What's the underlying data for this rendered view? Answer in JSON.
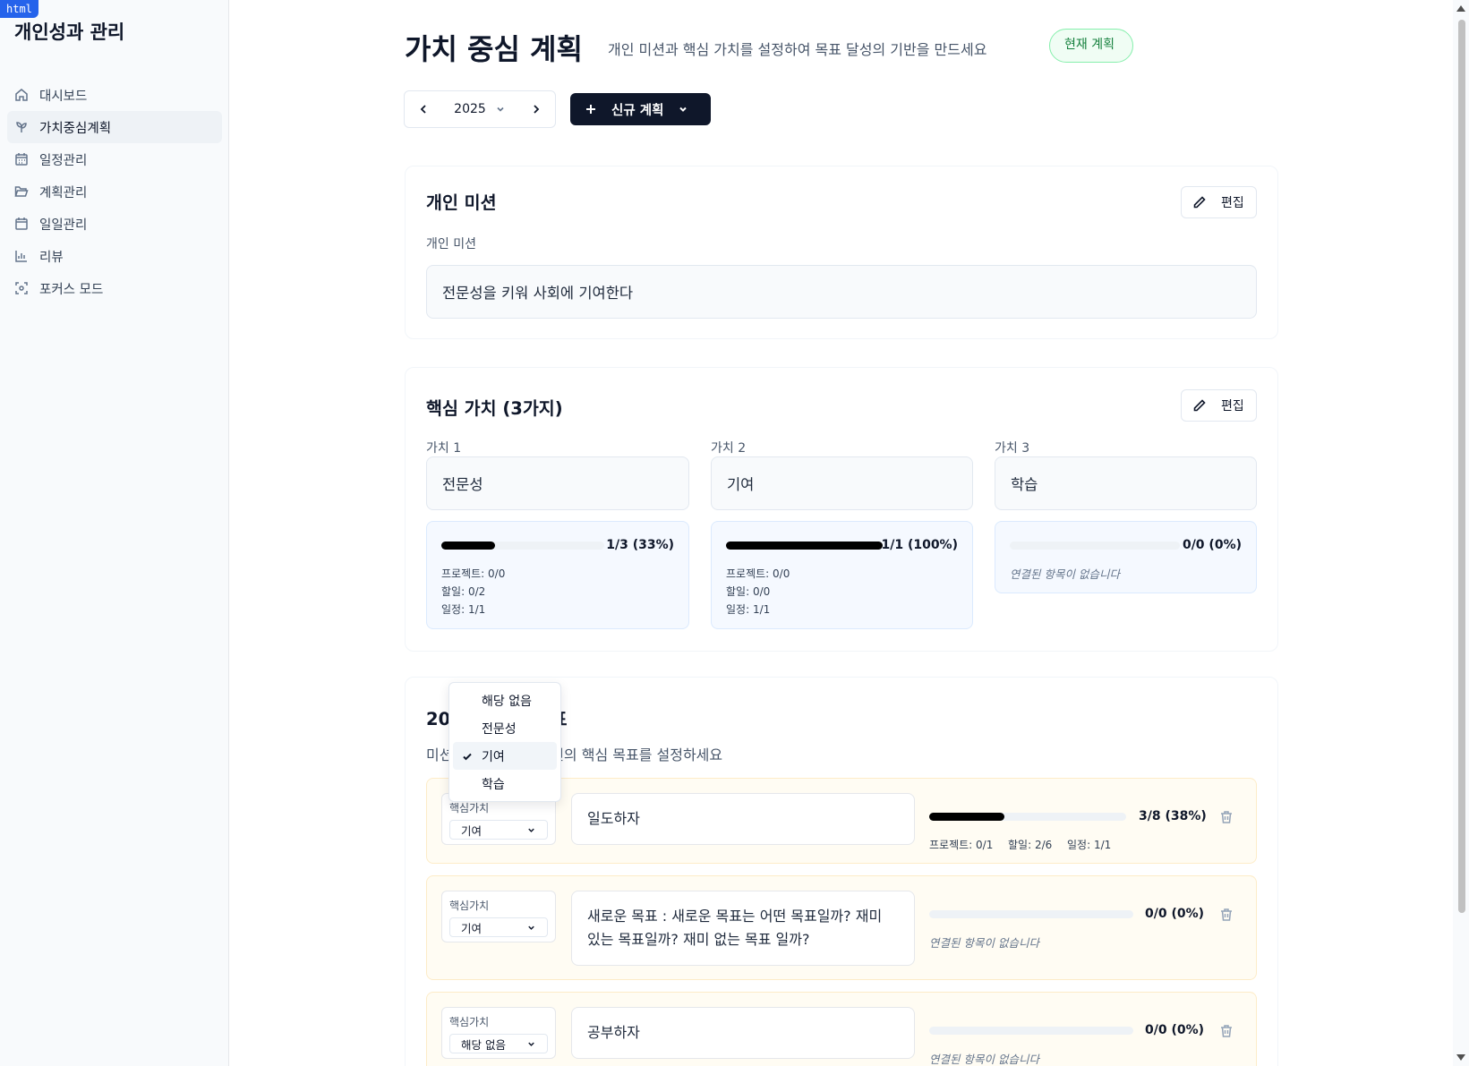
{
  "badge": "html",
  "sidebar": {
    "app_title": "개인성과 관리",
    "items": [
      {
        "label": "대시보드",
        "icon": "home-icon"
      },
      {
        "label": "가치중심계획",
        "icon": "sprout-icon"
      },
      {
        "label": "일정관리",
        "icon": "calendar-days-icon"
      },
      {
        "label": "계획관리",
        "icon": "folder-open-icon"
      },
      {
        "label": "일일관리",
        "icon": "calendar-icon"
      },
      {
        "label": "리뷰",
        "icon": "bar-chart-icon"
      },
      {
        "label": "포커스 모드",
        "icon": "focus-icon"
      }
    ]
  },
  "header": {
    "title": "가치 중심 계획",
    "subtitle": "개인 미션과 핵심 가치를 설정하여 목표 달성의 기반을 만드세요",
    "badge": "현재 계획"
  },
  "toolbar": {
    "year": "2025",
    "new_plan_label": "신규 계획"
  },
  "mission": {
    "title": "개인 미션",
    "edit_label": "편집",
    "field_label": "개인 미션",
    "value": "전문성을 키워 사회에 기여한다"
  },
  "values": {
    "title": "핵심 가치 (3가지)",
    "edit_label": "편집",
    "items": [
      {
        "label": "가치 1",
        "value": "전문성",
        "progress": 0.33,
        "progress_text": "1/3 (33%)",
        "stats": [
          "프로젝트: 0/0",
          "할일: 0/2",
          "일정: 1/1"
        ]
      },
      {
        "label": "가치 2",
        "value": "기여",
        "progress": 1.0,
        "progress_text": "1/1 (100%)",
        "stats": [
          "프로젝트: 0/0",
          "할일: 0/0",
          "일정: 1/1"
        ]
      },
      {
        "label": "가치 3",
        "value": "학습",
        "progress": 0.0,
        "progress_text": "0/0 (0%)",
        "empty_note": "연결된 항목이 없습니다"
      }
    ]
  },
  "goals": {
    "title": "2025년 연간 목표",
    "subtitle": "미션과 연결된 2025년의 핵심 목표를 설정하세요",
    "core_value_label": "핵심가치",
    "items": [
      {
        "core_value": "기여",
        "text": "일도하자",
        "progress": 0.38,
        "progress_text": "3/8 (38%)",
        "stats": [
          "프로젝트: 0/1",
          "할일: 2/6",
          "일정: 1/1"
        ]
      },
      {
        "core_value": "기여",
        "text": "새로운 목표 : 새로운 목표는 어떤 목표일까? 재미 있는 목표일까? 재미 없는 목표 일까?",
        "progress": 0.0,
        "progress_text": "0/0 (0%)",
        "empty_note": "연결된 항목이 없습니다"
      },
      {
        "core_value": "해당 없음",
        "text": "공부하자",
        "progress": 0.0,
        "progress_text": "0/0 (0%)",
        "empty_note": "연결된 항목이 없습니다"
      }
    ]
  },
  "dropdown": {
    "options": [
      "해당 없음",
      "전문성",
      "기여",
      "학습"
    ],
    "selected": "기여"
  },
  "colors": {
    "primary": "#0f172a",
    "badge_green": "#15803d",
    "value_box": "#f5f9ff",
    "goal_row": "#fffcf3"
  }
}
